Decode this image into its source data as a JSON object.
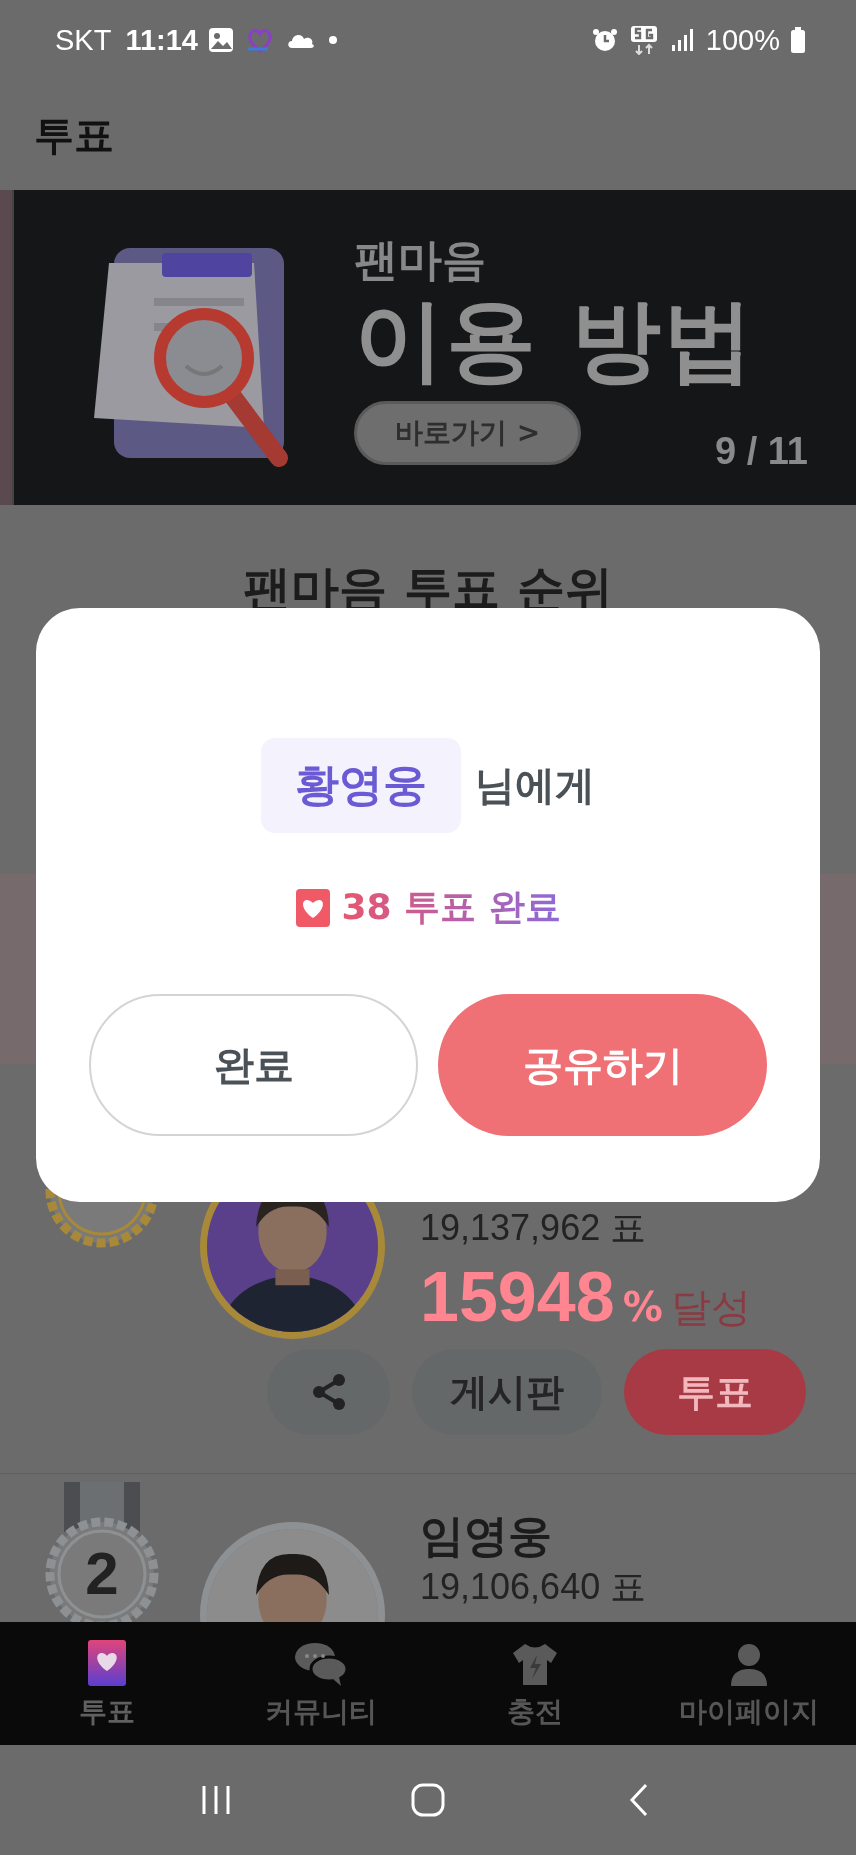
{
  "status_bar": {
    "carrier": "SKT",
    "time": "11:14",
    "battery": "100%"
  },
  "header": {
    "title": "투표"
  },
  "banner": {
    "subtitle": "팬마음",
    "title": "이용 방법",
    "button": "바로가기 >",
    "counter": "9 / 11"
  },
  "ranking": {
    "title": "팬마음 투표 순위",
    "entries": [
      {
        "color": "#a8893a",
        "votes": "19,137,962 표",
        "percent": "15948",
        "percent_sign": "%",
        "percent_label": "달성",
        "actions": [
          {
            "kind": "share"
          },
          {
            "kind": "board",
            "label": "게시판"
          },
          {
            "kind": "vote",
            "label": "투표"
          }
        ]
      },
      {
        "rank": "2",
        "color": "#8e9194",
        "name": "임영웅",
        "votes": "19,106,640 표"
      }
    ]
  },
  "dialog": {
    "recipient": "황영웅",
    "recipient_suffix": "님에게",
    "result": "38 투표 완료",
    "buttons": [
      {
        "kind": "outline",
        "label": "완료"
      },
      {
        "kind": "primary",
        "label": "공유하기"
      }
    ]
  },
  "bottom_nav": [
    {
      "kind": "vote",
      "label": "투표",
      "selected": true
    },
    {
      "kind": "community",
      "label": "커뮤니티",
      "selected": false
    },
    {
      "kind": "charge",
      "label": "충전",
      "selected": false
    },
    {
      "kind": "mypage",
      "label": "마이페이지",
      "selected": false
    }
  ]
}
